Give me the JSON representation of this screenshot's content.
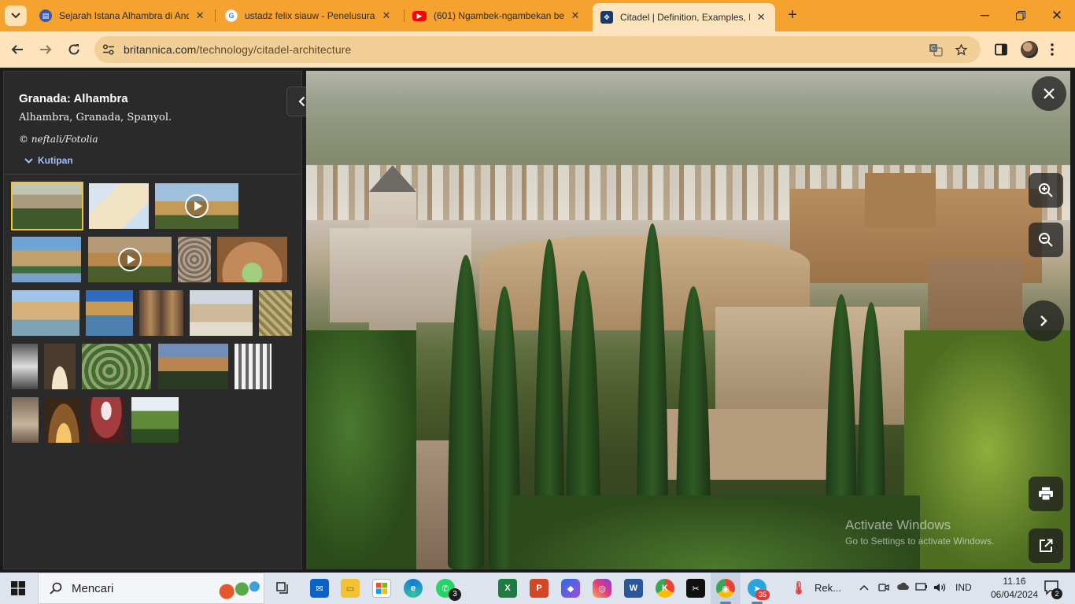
{
  "browser": {
    "tabs": [
      {
        "title": "Sejarah Istana Alhambra di Anda",
        "favicon": "news-icon",
        "color": "#3a57a8"
      },
      {
        "title": "ustadz felix siauw - Penelusuran",
        "favicon": "google-icon",
        "color": "#4285f4"
      },
      {
        "title": "(601) Ngambek-ngambekan be",
        "favicon": "youtube-icon",
        "color": "#ff0000"
      },
      {
        "title": "Citadel | Definition, Examples, H",
        "favicon": "britannica-icon",
        "color": "#1a3a6b"
      }
    ],
    "url_domain": "britannica.com",
    "url_path": "/technology/citadel-architecture",
    "accent": "#f6a22f"
  },
  "sidebar": {
    "title": "Granada: Alhambra",
    "description": "Alhambra, Granada, Spanyol.",
    "credit": "© neftali/Fotolia",
    "quote_label": "Kutipan"
  },
  "gallery": {
    "thumbs": [
      {
        "scene": "alhambra-panorama",
        "video": false,
        "selected": true
      },
      {
        "scene": "map-spain",
        "video": false
      },
      {
        "scene": "alhambra-hill",
        "video": true
      },
      {
        "scene": "palace-garden",
        "video": false
      },
      {
        "scene": "alhambra-sunset",
        "video": true
      },
      {
        "scene": "arabesque-ornament",
        "video": false
      },
      {
        "scene": "arched-hall",
        "video": false
      },
      {
        "scene": "court-of-myrtles",
        "video": false
      },
      {
        "scene": "reflecting-pool",
        "video": false
      },
      {
        "scene": "columned-hall",
        "video": false
      },
      {
        "scene": "court-of-lions",
        "video": false
      },
      {
        "scene": "carved-wall",
        "video": false
      },
      {
        "scene": "bw-arch",
        "video": false
      },
      {
        "scene": "arched-corridor",
        "video": false
      },
      {
        "scene": "hedge-garden",
        "video": false
      },
      {
        "scene": "alhambra-evening",
        "video": false
      },
      {
        "scene": "bw-colonnade",
        "video": false
      },
      {
        "scene": "mihrab",
        "video": false
      },
      {
        "scene": "golden-hall",
        "video": false
      },
      {
        "scene": "domed-room",
        "video": false
      },
      {
        "scene": "fountain-garden",
        "video": false
      }
    ]
  },
  "viewer": {
    "watermark_line1": "Activate Windows",
    "watermark_line2": "Go to Settings to activate Windows."
  },
  "taskbar": {
    "search_label": "Mencari",
    "whatsapp_badge": "3",
    "telegram_badge": "35",
    "weather_label": "Rek...",
    "language": "IND",
    "time": "11.16",
    "date": "06/04/2024",
    "notif_count": "2"
  }
}
